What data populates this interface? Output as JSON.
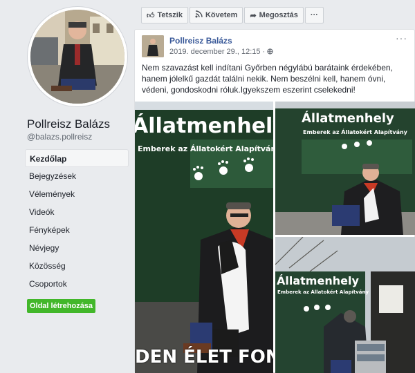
{
  "sidebar": {
    "page_name": "Pollreisz Balázs",
    "handle": "@balazs.pollreisz",
    "nav": [
      {
        "label": "Kezdőlap",
        "active": true
      },
      {
        "label": "Bejegyzések"
      },
      {
        "label": "Vélemények"
      },
      {
        "label": "Videók"
      },
      {
        "label": "Fényképek"
      },
      {
        "label": "Névjegy"
      },
      {
        "label": "Közösség"
      },
      {
        "label": "Csoportok"
      }
    ],
    "create_page_label": "Oldal létrehozása"
  },
  "actionbar": {
    "like_label": "Tetszik",
    "follow_label": "Követem",
    "share_label": "Megosztás",
    "more_label": "···"
  },
  "post": {
    "author": "Pollreisz Balázs",
    "date": "2019. december 29., 12:15",
    "date_suffix": "·",
    "more_label": "···",
    "text": "Nem szavazást kell indítani Győrben négylábú barátaink érdekében, hanem jólelkű gazdát találni nekik. Nem beszélni kell, hanem óvni, védeni, gondoskodni róluk.Igyekszem eszerint cselekedni!",
    "photos": {
      "sign_title": "Állatmenhely",
      "sign_subtitle": "Emberek az Állatokért Alapítvány",
      "banner_text": "DEN ÉLET FONTO"
    }
  },
  "colors": {
    "link": "#385898",
    "create_button": "#42b72a",
    "sign_green": "#1e4a2c"
  }
}
